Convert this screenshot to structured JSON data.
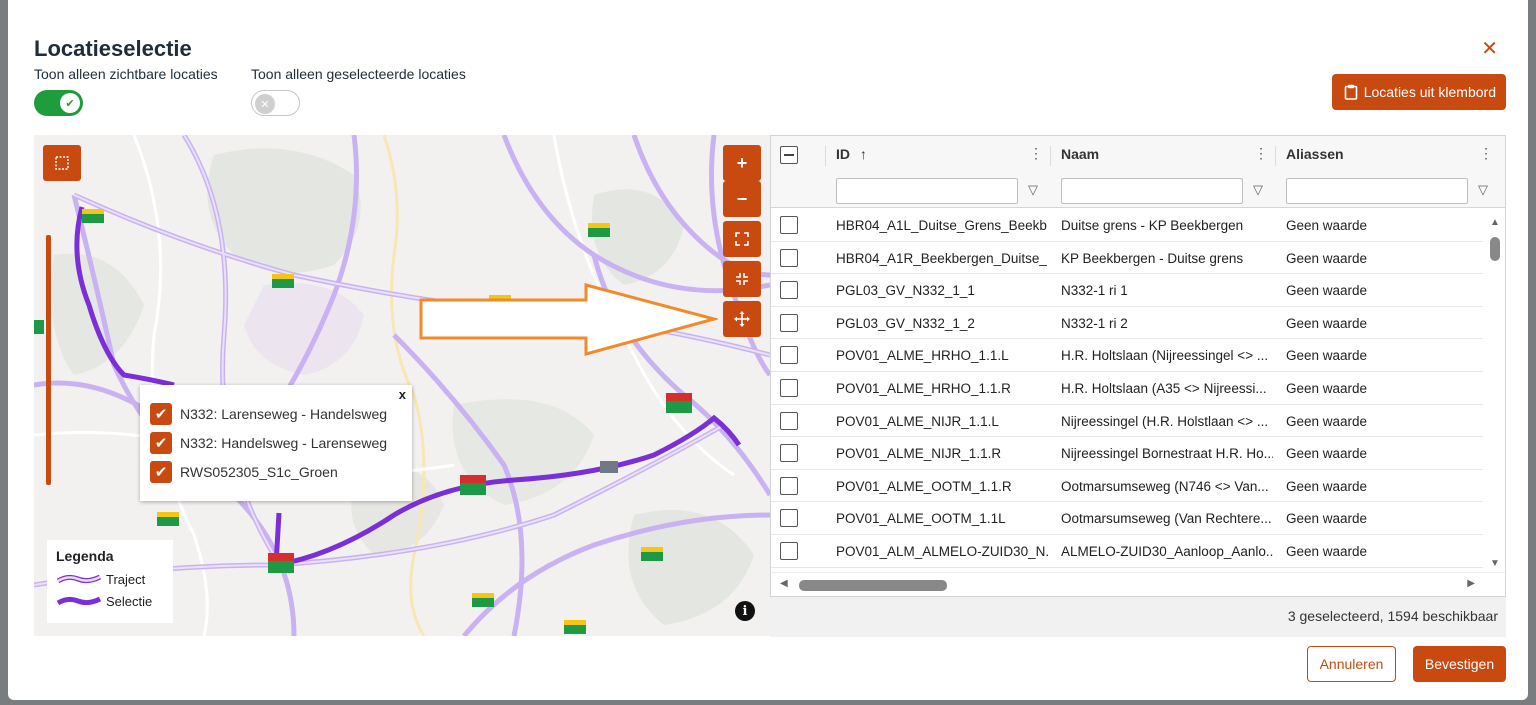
{
  "dialog": {
    "title": "Locatieselectie",
    "close_icon": "close-icon"
  },
  "toggles": {
    "visible_label": "Toon alleen zichtbare locaties",
    "visible_on": true,
    "selected_label": "Toon alleen geselecteerde locaties",
    "selected_on": false
  },
  "clipboard_button": {
    "label": "Locaties uit klembord",
    "icon": "clipboard-icon"
  },
  "map": {
    "controls": [
      "select-area-icon",
      "zoom-in-icon",
      "zoom-out-icon",
      "fullscreen-icon",
      "exit-fullscreen-icon",
      "pan-icon"
    ],
    "zoom_in": "+",
    "zoom_out": "−",
    "popup": {
      "items": [
        {
          "label": "N332: Larenseweg - Handelsweg",
          "checked": true
        },
        {
          "label": "N332: Handelsweg - Larenseweg",
          "checked": true
        },
        {
          "label": "RWS052305_S1c_Groen",
          "checked": true
        }
      ],
      "close": "x"
    },
    "legend": {
      "title": "Legenda",
      "items": [
        {
          "label": "Traject",
          "color": "#b893ee"
        },
        {
          "label": "Selectie",
          "color": "#7b2fd6"
        }
      ]
    },
    "info": "i"
  },
  "grid": {
    "columns": [
      {
        "label": "ID",
        "sort": "↑"
      },
      {
        "label": "Naam"
      },
      {
        "label": "Aliassen"
      }
    ],
    "rows": [
      {
        "id": "HBR04_A1L_Duitse_Grens_Beekb...",
        "naam": "Duitse grens - KP Beekbergen",
        "alias": "Geen waarde"
      },
      {
        "id": "HBR04_A1R_Beekbergen_Duitse_...",
        "naam": "KP Beekbergen - Duitse grens",
        "alias": "Geen waarde"
      },
      {
        "id": "PGL03_GV_N332_1_1",
        "naam": "N332-1 ri 1",
        "alias": "Geen waarde"
      },
      {
        "id": "PGL03_GV_N332_1_2",
        "naam": "N332-1 ri 2",
        "alias": "Geen waarde"
      },
      {
        "id": "POV01_ALME_HRHO_1.1.L",
        "naam": "H.R. Holtslaan (Nijreessingel <> ...",
        "alias": "Geen waarde"
      },
      {
        "id": "POV01_ALME_HRHO_1.1.R",
        "naam": "H.R. Holtslaan (A35 <> Nijreessi...",
        "alias": "Geen waarde"
      },
      {
        "id": "POV01_ALME_NIJR_1.1.L",
        "naam": "Nijreessingel (H.R. Holstlaan <> ...",
        "alias": "Geen waarde"
      },
      {
        "id": "POV01_ALME_NIJR_1.1.R",
        "naam": "Nijreessingel Bornestraat H.R. Ho...",
        "alias": "Geen waarde"
      },
      {
        "id": "POV01_ALME_OOTM_1.1.R",
        "naam": "Ootmarsumseweg (N746 <> Van...",
        "alias": "Geen waarde"
      },
      {
        "id": "POV01_ALME_OOTM_1.1L",
        "naam": "Ootmarsumseweg (Van Rechtere...",
        "alias": "Geen waarde"
      },
      {
        "id": "POV01_ALM_ALMELO-ZUID30_N...",
        "naam": "ALMELO-ZUID30_Aanloop_Aanlo...",
        "alias": "Geen waarde"
      }
    ],
    "status": "3 geselecteerd, 1594 beschikbaar"
  },
  "footer": {
    "cancel": "Annuleren",
    "confirm": "Bevestigen"
  },
  "colors": {
    "accent": "#c94a10",
    "toggle_on": "#1f9c3b",
    "selection": "#7b2fd6",
    "traject": "#b893ee"
  }
}
